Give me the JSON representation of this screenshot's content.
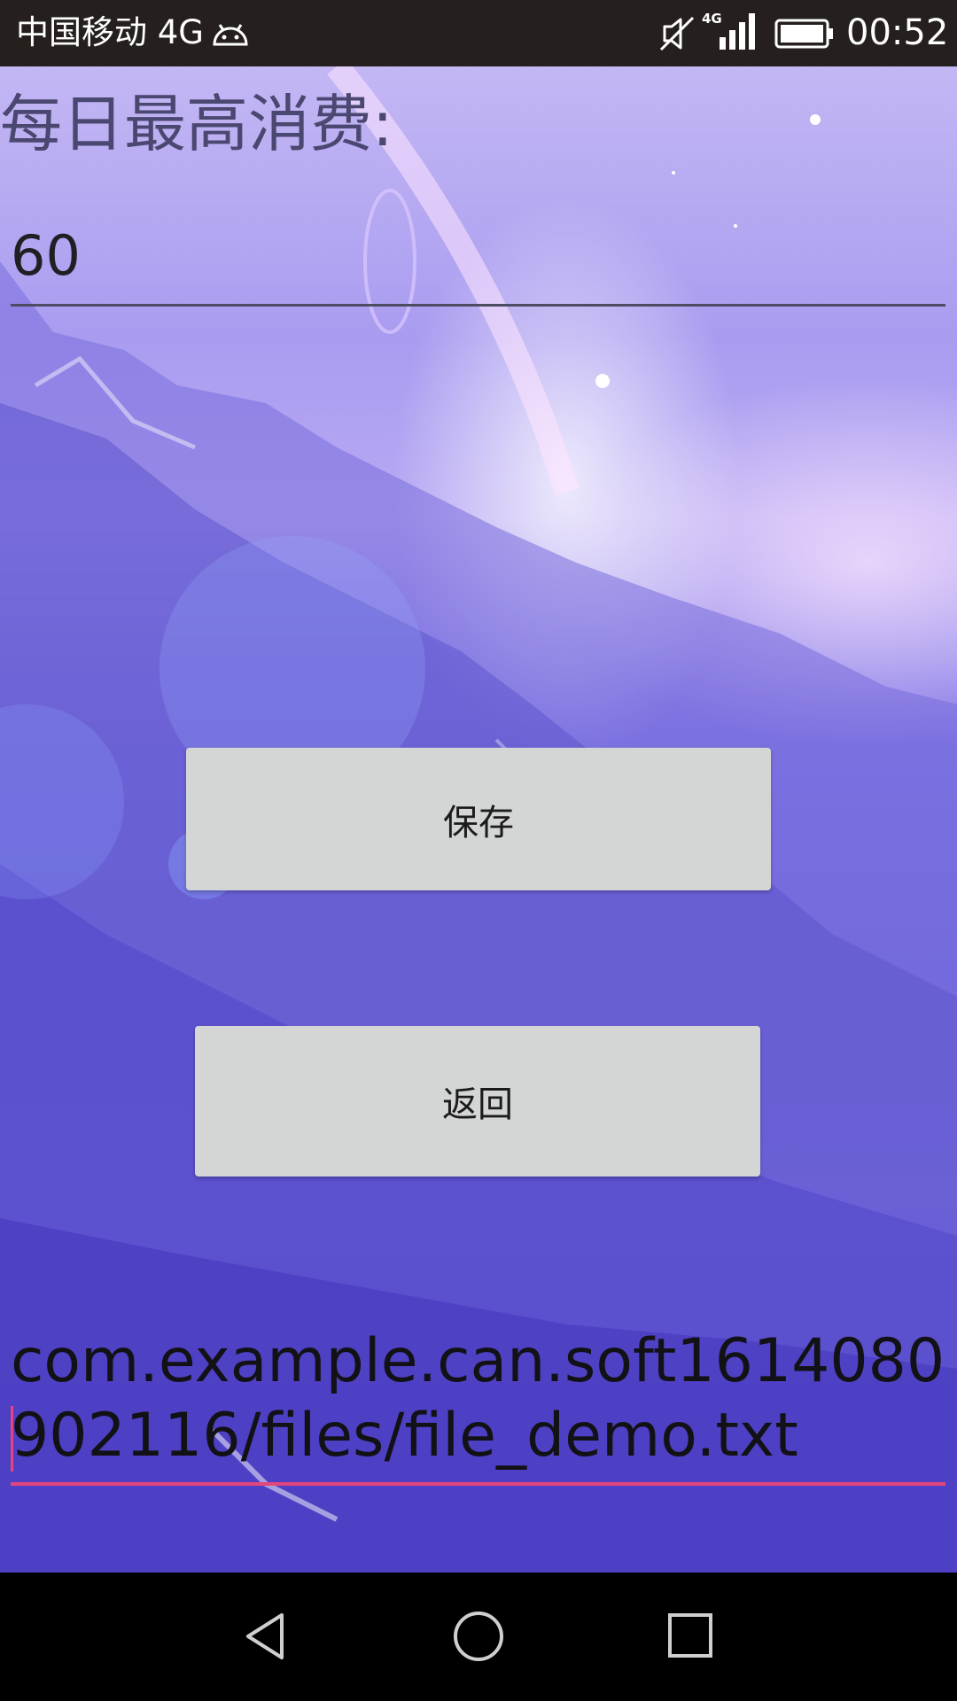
{
  "status_bar": {
    "carrier": "中国移动 4G",
    "network_badge": "4G",
    "time": "00:52",
    "icons": [
      "android-icon",
      "mute-icon",
      "signal-icon",
      "battery-icon"
    ]
  },
  "main": {
    "label": "每日最高消费:",
    "amount_value": "60",
    "save_label": "保存",
    "back_label": "返回",
    "file_path": "com.example.can.soft1614080902116/files/file_demo.txt"
  },
  "nav_bar": {
    "icons": [
      "back-triangle-icon",
      "home-circle-icon",
      "recent-apps-square-icon"
    ]
  },
  "colors": {
    "status_bar_bg": "#25201d",
    "button_bg": "#d4d6d6",
    "accent_underline": "#e4457b",
    "label_color": "#4a4770"
  }
}
